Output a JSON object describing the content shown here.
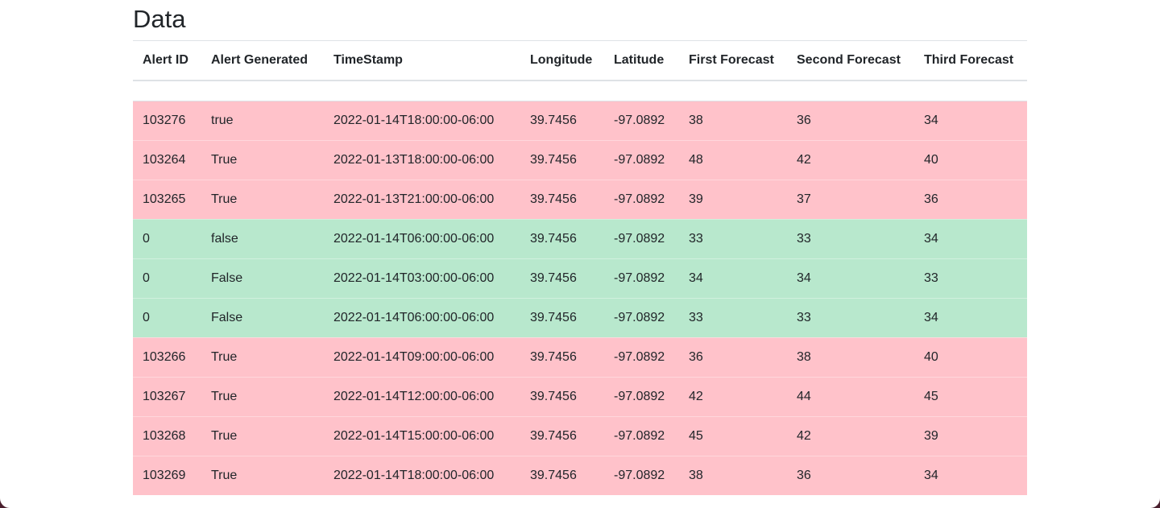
{
  "page": {
    "title": "Data"
  },
  "colors": {
    "alert_row": "#ffc2ca",
    "ok_row": "#b8e8cd"
  },
  "table": {
    "headers": [
      "Alert ID",
      "Alert Generated",
      "TimeStamp",
      "Longitude",
      "Latitude",
      "First Forecast",
      "Second Forecast",
      "Third Forecast"
    ],
    "rows": [
      {
        "status": "alert",
        "cells": [
          "103276",
          "true",
          "2022-01-14T18:00:00-06:00",
          "39.7456",
          "-97.0892",
          "38",
          "36",
          "34"
        ]
      },
      {
        "status": "alert",
        "cells": [
          "103264",
          "True",
          "2022-01-13T18:00:00-06:00",
          "39.7456",
          "-97.0892",
          "48",
          "42",
          "40"
        ]
      },
      {
        "status": "alert",
        "cells": [
          "103265",
          "True",
          "2022-01-13T21:00:00-06:00",
          "39.7456",
          "-97.0892",
          "39",
          "37",
          "36"
        ]
      },
      {
        "status": "ok",
        "cells": [
          "0",
          "false",
          "2022-01-14T06:00:00-06:00",
          "39.7456",
          "-97.0892",
          "33",
          "33",
          "34"
        ]
      },
      {
        "status": "ok",
        "cells": [
          "0",
          "False",
          "2022-01-14T03:00:00-06:00",
          "39.7456",
          "-97.0892",
          "34",
          "34",
          "33"
        ]
      },
      {
        "status": "ok",
        "cells": [
          "0",
          "False",
          "2022-01-14T06:00:00-06:00",
          "39.7456",
          "-97.0892",
          "33",
          "33",
          "34"
        ]
      },
      {
        "status": "alert",
        "cells": [
          "103266",
          "True",
          "2022-01-14T09:00:00-06:00",
          "39.7456",
          "-97.0892",
          "36",
          "38",
          "40"
        ]
      },
      {
        "status": "alert",
        "cells": [
          "103267",
          "True",
          "2022-01-14T12:00:00-06:00",
          "39.7456",
          "-97.0892",
          "42",
          "44",
          "45"
        ]
      },
      {
        "status": "alert",
        "cells": [
          "103268",
          "True",
          "2022-01-14T15:00:00-06:00",
          "39.7456",
          "-97.0892",
          "45",
          "42",
          "39"
        ]
      },
      {
        "status": "alert",
        "cells": [
          "103269",
          "True",
          "2022-01-14T18:00:00-06:00",
          "39.7456",
          "-97.0892",
          "38",
          "36",
          "34"
        ]
      }
    ]
  }
}
